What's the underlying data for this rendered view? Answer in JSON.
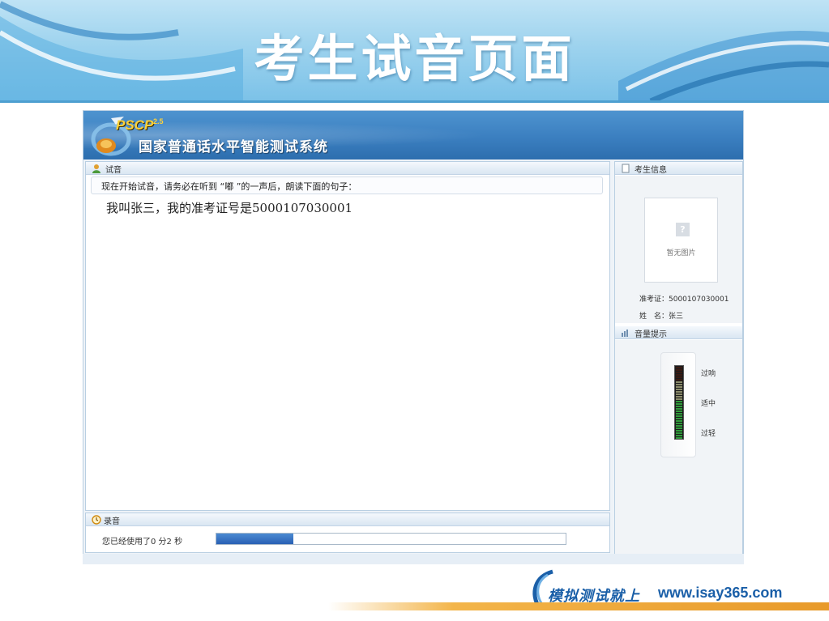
{
  "slide": {
    "title": "考生试音页面"
  },
  "app": {
    "logo": "PSCP",
    "logo_version": "2.5",
    "title": "国家普通话水平智能测试系统"
  },
  "trial": {
    "section_title": "试音",
    "instruction": "现在开始试音，请务必在听到 “嘟 ”的一声后，朗读下面的句子：",
    "sentence": "我叫张三，我的准考证号是5000107030001"
  },
  "record": {
    "section_title": "录音",
    "elapsed_prefix": "您已经使用了0 分2 秒",
    "progress_fraction": 0.22
  },
  "candidate": {
    "section_title": "考生信息",
    "photo_placeholder": "暂无图片",
    "photo_icon": "?",
    "ticket_line": "准考证：5000107030001",
    "name_line": "姓　名：张三"
  },
  "volume": {
    "section_title": "音量提示",
    "levels": [
      "过响",
      "适中",
      "过轻"
    ]
  },
  "footer": {
    "brand_cn": "模拟测试就上",
    "brand_url": "www.isay365.com"
  }
}
